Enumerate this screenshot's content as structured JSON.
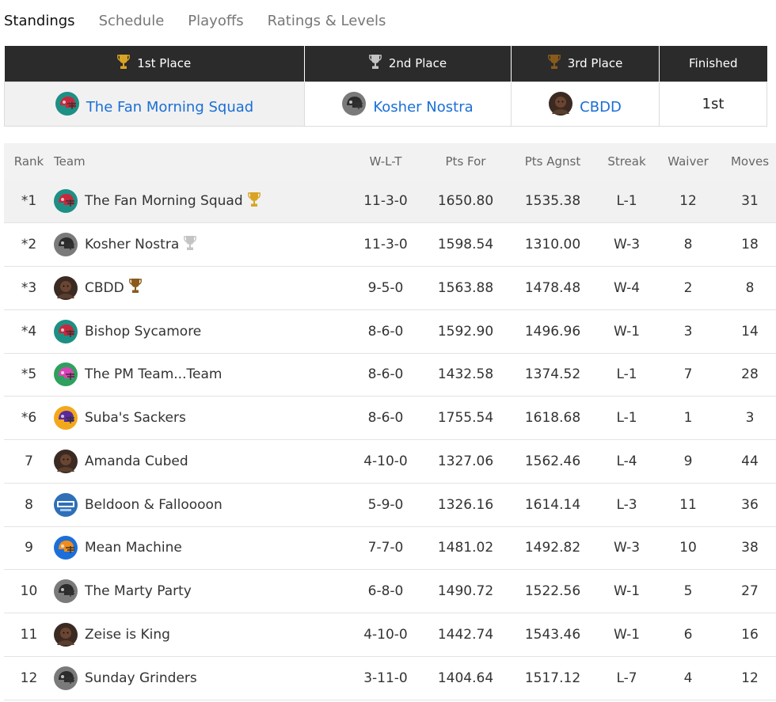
{
  "tabs": [
    {
      "label": "Standings",
      "active": true
    },
    {
      "label": "Schedule",
      "active": false
    },
    {
      "label": "Playoffs",
      "active": false
    },
    {
      "label": "Ratings & Levels",
      "active": false
    }
  ],
  "podium": {
    "headers": [
      "1st Place",
      "2nd Place",
      "3rd Place",
      "Finished"
    ],
    "teams": [
      {
        "name": "The Fan Morning Squad",
        "icon": "red-helmet-icon"
      },
      {
        "name": "Kosher Nostra",
        "icon": "gray-helmet-icon"
      },
      {
        "name": "CBDD",
        "icon": "photo-avatar-icon"
      }
    ],
    "finished": "1st"
  },
  "standings": {
    "columns": [
      "Rank",
      "Team",
      "W-L-T",
      "Pts For",
      "Pts Agnst",
      "Streak",
      "Waiver",
      "Moves"
    ],
    "rows": [
      {
        "rank": "*1",
        "team": "The Fan Morning Squad",
        "wlt": "11-3-0",
        "pf": "1650.80",
        "pa": "1535.38",
        "streak": "L-1",
        "waiver": "12",
        "moves": "31",
        "icon": "red-helmet-icon",
        "trophy": "gold"
      },
      {
        "rank": "*2",
        "team": "Kosher Nostra",
        "wlt": "11-3-0",
        "pf": "1598.54",
        "pa": "1310.00",
        "streak": "W-3",
        "waiver": "8",
        "moves": "18",
        "icon": "gray-helmet-icon",
        "trophy": "silver"
      },
      {
        "rank": "*3",
        "team": "CBDD",
        "wlt": "9-5-0",
        "pf": "1563.88",
        "pa": "1478.48",
        "streak": "W-4",
        "waiver": "2",
        "moves": "8",
        "icon": "photo-avatar-icon",
        "trophy": "bronze"
      },
      {
        "rank": "*4",
        "team": "Bishop Sycamore",
        "wlt": "8-6-0",
        "pf": "1592.90",
        "pa": "1496.96",
        "streak": "W-1",
        "waiver": "3",
        "moves": "14",
        "icon": "red-helmet-icon",
        "trophy": ""
      },
      {
        "rank": "*5",
        "team": "The PM Team...Team",
        "wlt": "8-6-0",
        "pf": "1432.58",
        "pa": "1374.52",
        "streak": "L-1",
        "waiver": "7",
        "moves": "28",
        "icon": "pink-helmet-icon",
        "trophy": ""
      },
      {
        "rank": "*6",
        "team": "Suba's Sackers",
        "wlt": "8-6-0",
        "pf": "1755.54",
        "pa": "1618.68",
        "streak": "L-1",
        "waiver": "1",
        "moves": "3",
        "icon": "purple-helmet-icon",
        "trophy": ""
      },
      {
        "rank": "7",
        "team": "Amanda Cubed",
        "wlt": "4-10-0",
        "pf": "1327.06",
        "pa": "1562.46",
        "streak": "L-4",
        "waiver": "9",
        "moves": "44",
        "icon": "photo-avatar-icon",
        "trophy": ""
      },
      {
        "rank": "8",
        "team": "Beldoon & Falloooon",
        "wlt": "5-9-0",
        "pf": "1326.16",
        "pa": "1614.14",
        "streak": "L-3",
        "waiver": "11",
        "moves": "36",
        "icon": "kdka-logo-icon",
        "trophy": ""
      },
      {
        "rank": "9",
        "team": "Mean Machine",
        "wlt": "7-7-0",
        "pf": "1481.02",
        "pa": "1492.82",
        "streak": "W-3",
        "waiver": "10",
        "moves": "38",
        "icon": "blue-helmet-icon",
        "trophy": ""
      },
      {
        "rank": "10",
        "team": "The Marty Party",
        "wlt": "6-8-0",
        "pf": "1490.72",
        "pa": "1522.56",
        "streak": "W-1",
        "waiver": "5",
        "moves": "27",
        "icon": "gray-helmet-icon",
        "trophy": ""
      },
      {
        "rank": "11",
        "team": "Zeise is King",
        "wlt": "4-10-0",
        "pf": "1442.74",
        "pa": "1543.46",
        "streak": "W-1",
        "waiver": "6",
        "moves": "16",
        "icon": "photo-avatar-icon",
        "trophy": ""
      },
      {
        "rank": "12",
        "team": "Sunday Grinders",
        "wlt": "3-11-0",
        "pf": "1404.64",
        "pa": "1517.12",
        "streak": "L-7",
        "waiver": "4",
        "moves": "12",
        "icon": "gray-helmet-icon",
        "trophy": ""
      }
    ]
  },
  "colors": {
    "link": "#1a6fd6",
    "header_dark": "#2b2b2b",
    "gold": "#d9a423",
    "silver": "#c4c4c4",
    "bronze": "#8a5a1c"
  }
}
